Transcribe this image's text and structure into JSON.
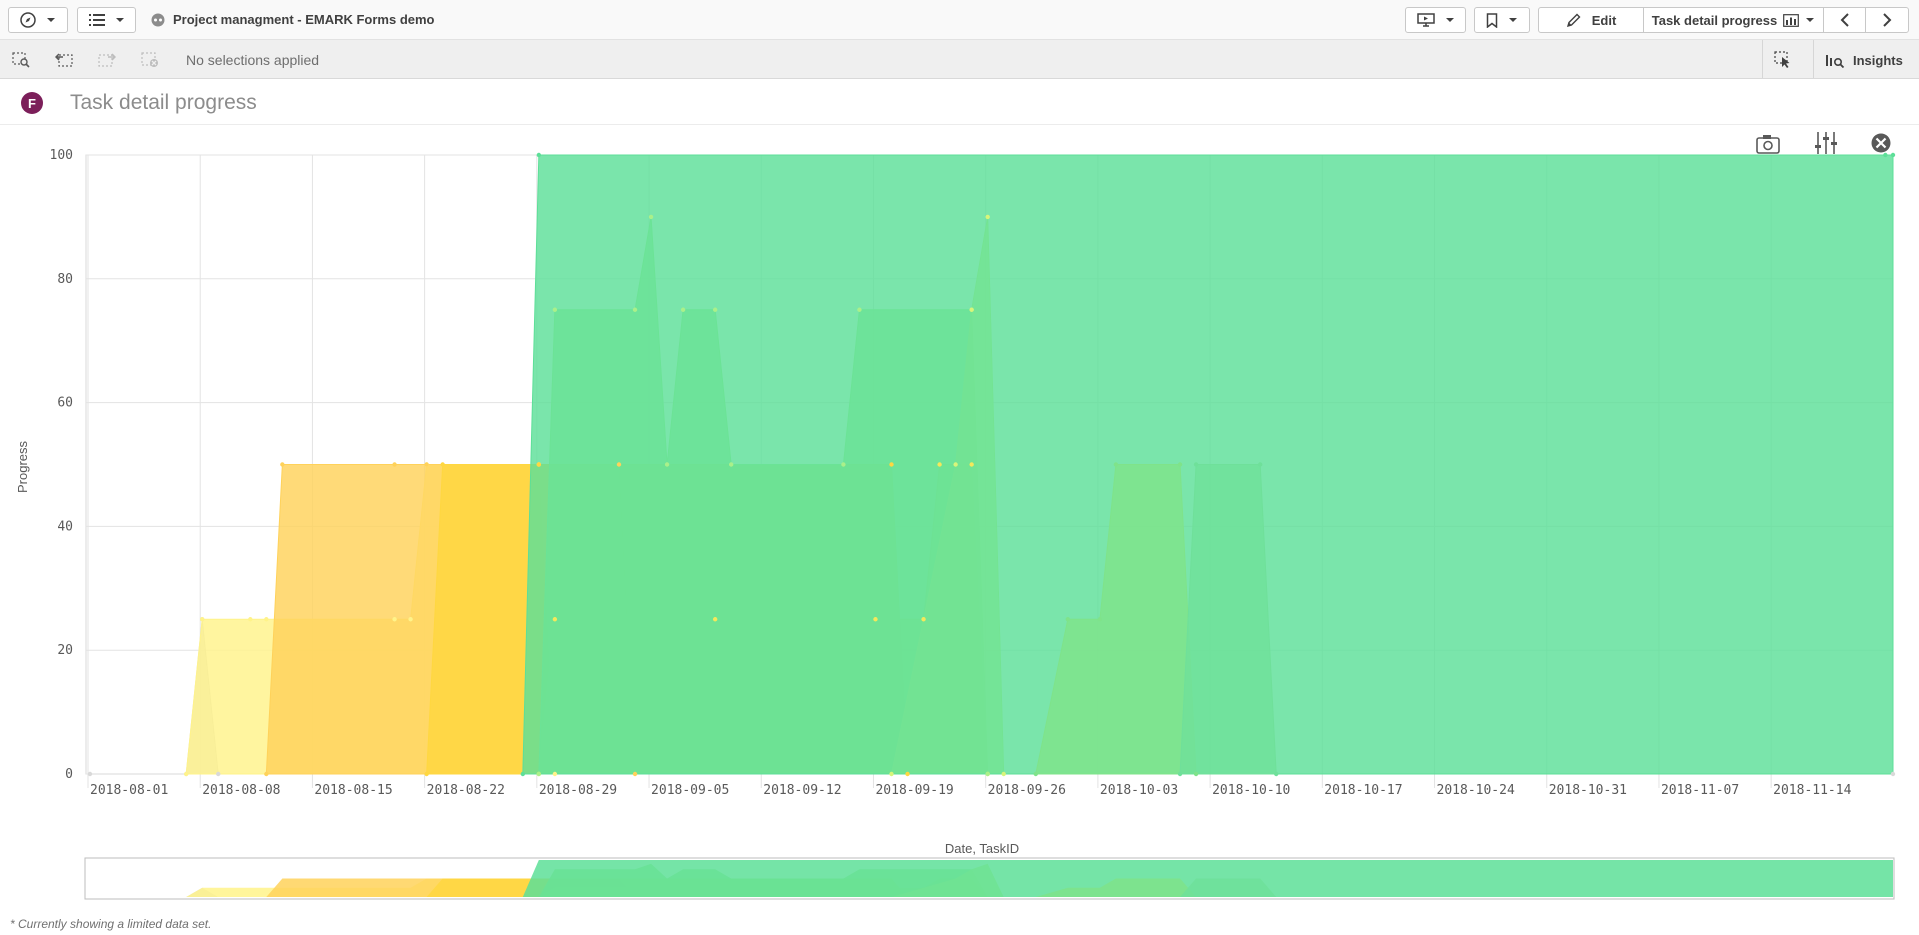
{
  "toolbar": {
    "app_title": "Project managment - EMARK Forms demo",
    "edit_label": "Edit",
    "sheet_label": "Task detail progress"
  },
  "selections": {
    "status_text": "No selections applied",
    "insights_label": "Insights"
  },
  "sheet": {
    "badge": "F",
    "title": "Task detail progress"
  },
  "colors": {
    "green": "#5ddf98",
    "yellow": "#ffd740",
    "pale_yellow": "#fff38a",
    "light_green": "#aaf08a"
  },
  "icons": [
    "compass-icon",
    "list-icon",
    "app-icon",
    "smart-search-icon",
    "step-back-icon",
    "step-forward-icon",
    "clear-selections-icon",
    "present-icon",
    "bookmark-icon",
    "pencil-icon",
    "chart-icon",
    "chevron-left-icon",
    "chevron-right-icon",
    "selection-tool-icon",
    "insights-icon",
    "camera-icon",
    "sliders-icon",
    "close-icon"
  ],
  "chart_data": {
    "type": "area",
    "xlabel": "Date, TaskID",
    "ylabel": "Progress",
    "ylim": [
      0,
      100
    ],
    "yticks": [
      0,
      20,
      40,
      60,
      80,
      100
    ],
    "xticks": [
      "2018-08-01",
      "2018-08-08",
      "2018-08-15",
      "2018-08-22",
      "2018-08-29",
      "2018-09-05",
      "2018-09-12",
      "2018-09-19",
      "2018-09-26",
      "2018-10-03",
      "2018-10-10",
      "2018-10-17",
      "2018-10-24",
      "2018-10-31",
      "2018-11-07",
      "2018-11-14"
    ],
    "grid": true,
    "series": [
      {
        "color": "#d9d9d9",
        "points": [
          [
            "2018-08-01",
            0
          ],
          [
            "2018-08-07",
            0
          ],
          [
            "2018-08-08",
            25
          ],
          [
            "2018-08-09",
            0
          ],
          [
            "2018-11-22",
            0
          ]
        ]
      },
      {
        "color": "#fff38a",
        "points": [
          [
            "2018-08-07",
            0
          ],
          [
            "2018-08-08",
            25
          ],
          [
            "2018-08-11",
            25
          ],
          [
            "2018-08-12",
            25
          ],
          [
            "2018-08-20",
            25
          ],
          [
            "2018-08-21",
            25
          ],
          [
            "2018-08-22",
            50
          ],
          [
            "2018-08-29",
            50
          ],
          [
            "2018-08-30",
            0
          ]
        ]
      },
      {
        "color": "#ffd25a",
        "points": [
          [
            "2018-08-12",
            0
          ],
          [
            "2018-08-13",
            50
          ],
          [
            "2018-08-20",
            50
          ],
          [
            "2018-08-22",
            50
          ],
          [
            "2018-08-29",
            50
          ],
          [
            "2018-09-03",
            50
          ],
          [
            "2018-09-04",
            0
          ]
        ]
      },
      {
        "color": "#ffd740",
        "points": [
          [
            "2018-08-22",
            0
          ],
          [
            "2018-08-23",
            50
          ],
          [
            "2018-08-29",
            50
          ],
          [
            "2018-09-20",
            50
          ],
          [
            "2018-09-21",
            0
          ]
        ]
      },
      {
        "color": "#f5e85a",
        "points": [
          [
            "2018-08-29",
            0
          ],
          [
            "2018-08-30",
            25
          ],
          [
            "2018-09-09",
            25
          ],
          [
            "2018-09-19",
            25
          ],
          [
            "2018-09-22",
            25
          ],
          [
            "2018-09-23",
            50
          ],
          [
            "2018-09-25",
            50
          ],
          [
            "2018-09-26",
            0
          ]
        ]
      },
      {
        "color": "#aaf08a",
        "points": [
          [
            "2018-08-29",
            0
          ],
          [
            "2018-08-30",
            75
          ],
          [
            "2018-09-04",
            75
          ],
          [
            "2018-09-05",
            90
          ],
          [
            "2018-09-06",
            50
          ],
          [
            "2018-09-07",
            75
          ],
          [
            "2018-09-09",
            75
          ],
          [
            "2018-09-10",
            50
          ],
          [
            "2018-09-17",
            50
          ],
          [
            "2018-09-18",
            75
          ],
          [
            "2018-09-25",
            75
          ],
          [
            "2018-09-26",
            0
          ]
        ]
      },
      {
        "color": "#d8f57a",
        "points": [
          [
            "2018-09-20",
            0
          ],
          [
            "2018-09-24",
            50
          ],
          [
            "2018-09-25",
            75
          ],
          [
            "2018-09-26",
            90
          ],
          [
            "2018-09-27",
            0
          ]
        ]
      },
      {
        "color": "#5ddf98",
        "points": [
          [
            "2018-08-28",
            0
          ],
          [
            "2018-08-29",
            100
          ],
          [
            "2018-11-21",
            100
          ],
          [
            "2018-11-22",
            100
          ]
        ]
      },
      {
        "color": "#7fe38a",
        "points": [
          [
            "2018-09-29",
            0
          ],
          [
            "2018-10-01",
            25
          ],
          [
            "2018-10-03",
            25
          ],
          [
            "2018-10-04",
            50
          ],
          [
            "2018-10-08",
            50
          ],
          [
            "2018-10-09",
            0
          ]
        ]
      },
      {
        "color": "#6fe09a",
        "points": [
          [
            "2018-10-08",
            0
          ],
          [
            "2018-10-09",
            50
          ],
          [
            "2018-10-13",
            50
          ],
          [
            "2018-10-14",
            0
          ]
        ]
      }
    ],
    "minimap": true
  },
  "footnote": "* Currently showing a limited data set."
}
